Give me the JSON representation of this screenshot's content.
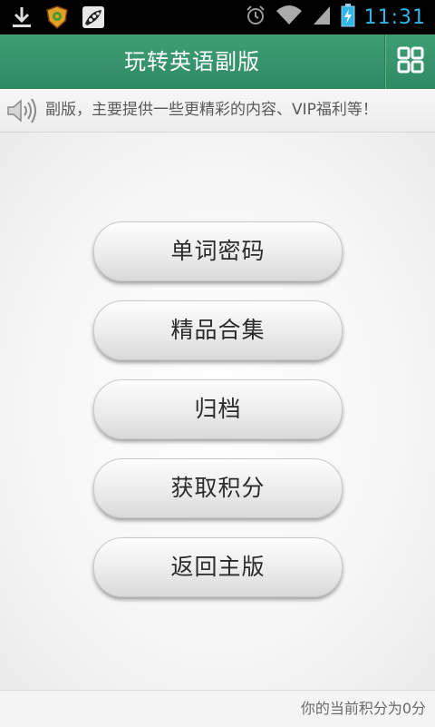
{
  "status_bar": {
    "time": "11:31",
    "icons": [
      "download-icon",
      "shield-app-icon",
      "pea-app-icon",
      "alarm-icon",
      "wifi-icon",
      "signal-icon",
      "battery-charging-icon"
    ]
  },
  "header": {
    "title": "玩转英语副版",
    "grid_icon": "grid-icon"
  },
  "notice": {
    "icon": "speaker-icon",
    "text": "副版，主要提供一些更精彩的内容、VIP福利等！"
  },
  "menu": {
    "items": [
      {
        "label": "单词密码"
      },
      {
        "label": "精品合集"
      },
      {
        "label": "归档"
      },
      {
        "label": "获取积分"
      },
      {
        "label": "返回主版"
      }
    ]
  },
  "footer": {
    "points_text": "你的当前积分为0分"
  },
  "colors": {
    "header": "#3a956d",
    "time": "#31b6e7"
  }
}
